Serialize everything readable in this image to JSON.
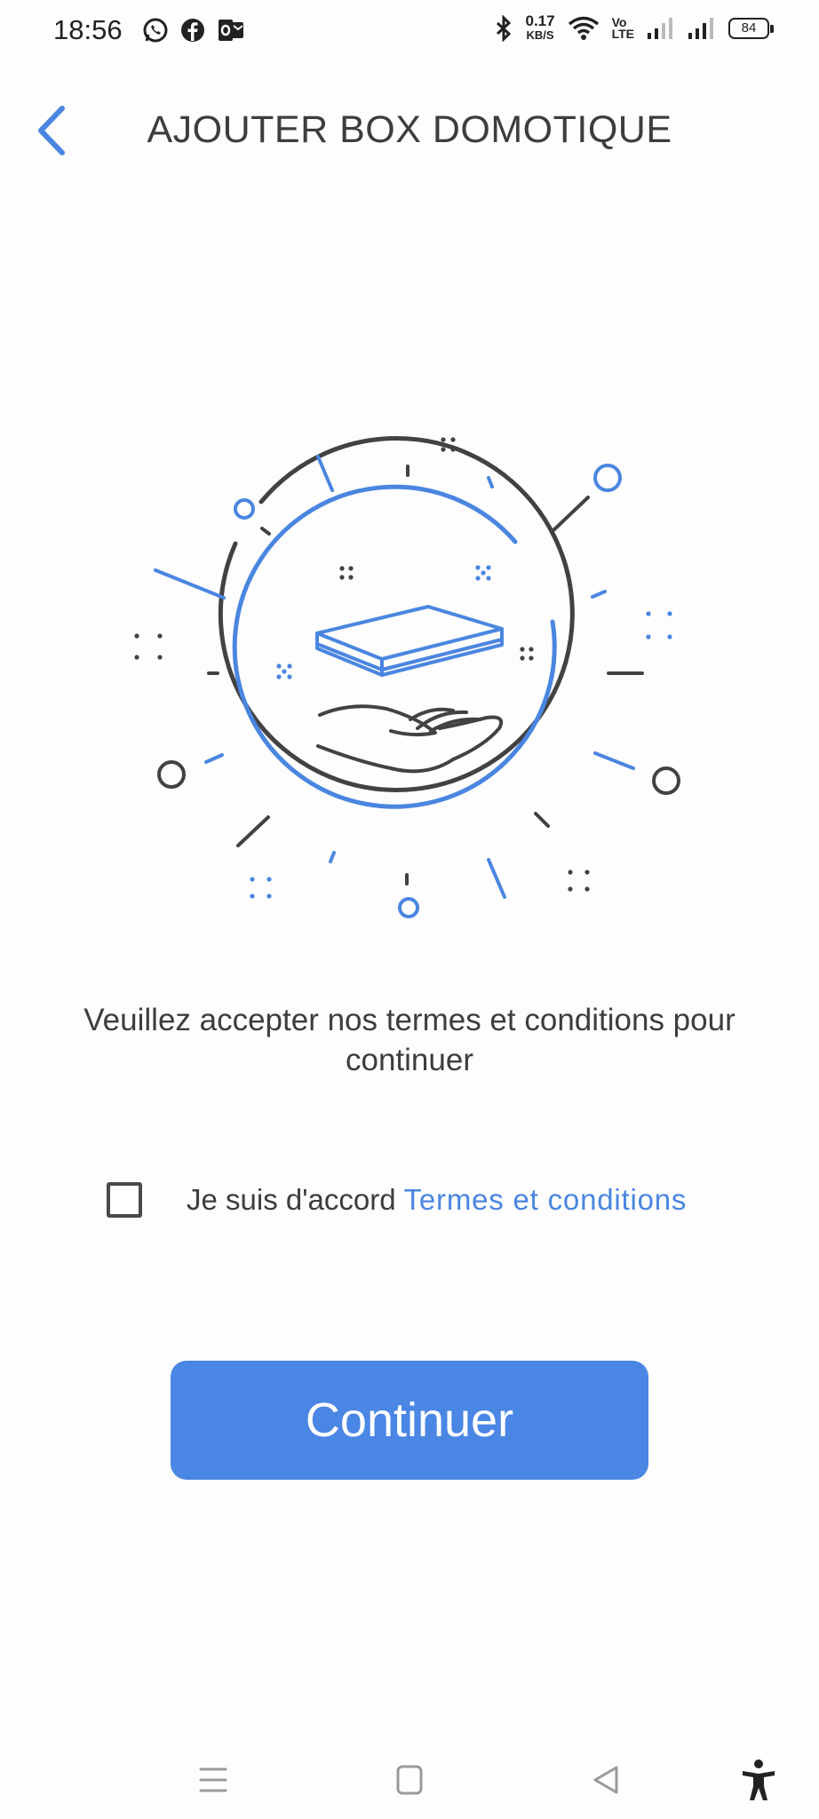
{
  "status_bar": {
    "time": "18:56",
    "net_speed_value": "0.17",
    "net_speed_unit": "KB/S",
    "volte_top": "Vo",
    "volte_bottom": "LTE",
    "battery": "84",
    "left_icons": [
      "whatsapp-icon",
      "facebook-icon",
      "outlook-icon"
    ],
    "right_icons": [
      "bluetooth-icon",
      "wifi-icon",
      "signal-icon",
      "signal-icon"
    ]
  },
  "header": {
    "title": "AJOUTER BOX DOMOTIQUE",
    "back_icon": "chevron-left-icon"
  },
  "illustration": {
    "icon": "hand-offering-box-icon",
    "colors": {
      "blue": "#4a86e0",
      "dark": "#424242"
    }
  },
  "main": {
    "prompt": "Veuillez accepter nos termes et conditions pour continuer",
    "agree": {
      "checked": false,
      "label": "Je suis d'accord",
      "link": "Termes et conditions"
    },
    "continue_label": "Continuer"
  },
  "nav_bar": {
    "icons": [
      "menu-icon",
      "home-square-icon",
      "back-triangle-icon",
      "accessibility-icon"
    ]
  },
  "colors": {
    "accent": "#4a86e4",
    "text": "#3d3d3d",
    "background": "#fdfdfd"
  }
}
